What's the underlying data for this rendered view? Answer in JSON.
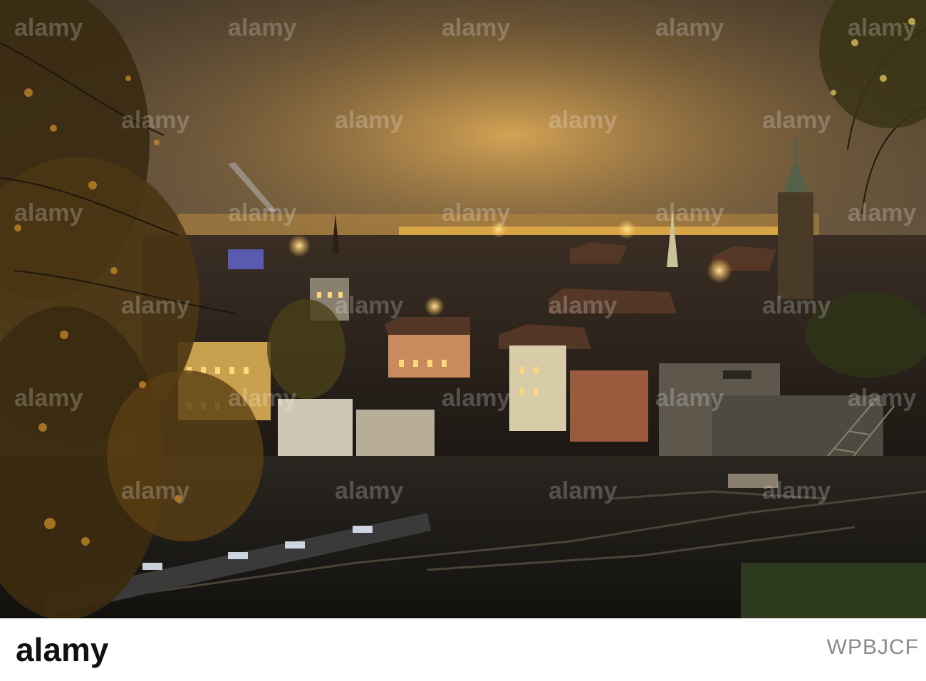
{
  "photo": {
    "subject": "night-cityscape",
    "sky_color": "#6e5c44",
    "glow_color": "#f2b64a",
    "foliage_color": "#7a5a1c"
  },
  "footer": {
    "brand_name": "alamy",
    "image_id": "WPBJCF",
    "colors": {
      "background": "#ffffff",
      "brand_text": "#111111",
      "id_text": "#8a8a8a"
    }
  },
  "watermark": {
    "repeating_text": "alamy",
    "color": "#ffffff"
  }
}
